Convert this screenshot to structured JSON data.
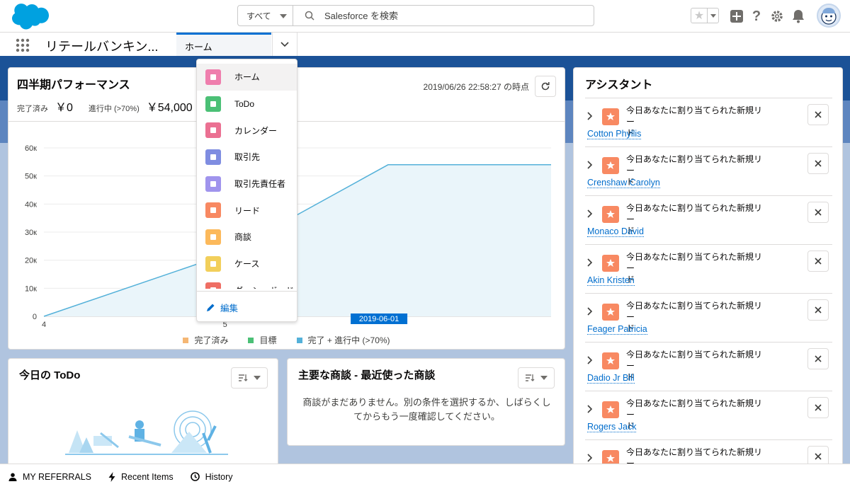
{
  "header": {
    "search_scope": "すべて",
    "search_placeholder": "Salesforce を検索"
  },
  "nav": {
    "app_name": "リテールバンキン...",
    "active_tab": "ホーム"
  },
  "dropdown": {
    "items": [
      {
        "label": "ホーム",
        "icon": "home-icon",
        "color": "#ef7ead"
      },
      {
        "label": "ToDo",
        "icon": "task-icon",
        "color": "#4bc076"
      },
      {
        "label": "カレンダー",
        "icon": "calendar-icon",
        "color": "#eb7092"
      },
      {
        "label": "取引先",
        "icon": "account-icon",
        "color": "#7f8de1"
      },
      {
        "label": "取引先責任者",
        "icon": "contact-icon",
        "color": "#a094ed"
      },
      {
        "label": "リード",
        "icon": "lead-icon",
        "color": "#f88962"
      },
      {
        "label": "商談",
        "icon": "opportunity-icon",
        "color": "#fcb95b"
      },
      {
        "label": "ケース",
        "icon": "case-icon",
        "color": "#f2cf5b"
      },
      {
        "label": "ダッシュボード",
        "icon": "dashboard-icon",
        "color": "#ef6e64"
      }
    ],
    "edit_label": "編集"
  },
  "performance": {
    "title": "四半期パフォーマンス",
    "closed_label": "完了済み",
    "closed_value": "￥0",
    "open_label": "進行中 (>70%)",
    "open_value": "￥54,000",
    "timestamp": "2019/06/26 22:58:27 の時点"
  },
  "chart_data": {
    "type": "area",
    "x": [
      4,
      5,
      5.9,
      6.8
    ],
    "x_ticks": [
      "4",
      "5"
    ],
    "xlim": [
      4,
      6.8
    ],
    "ylim": [
      0,
      60000
    ],
    "y_ticks": [
      "0",
      "10к",
      "20к",
      "30к",
      "40к",
      "50к",
      "60к"
    ],
    "series": [
      {
        "name": "完了 + 進行中 (>70%)",
        "values": [
          0,
          22000,
          54000,
          54000
        ],
        "color": "#54b1d9"
      }
    ],
    "legend": [
      {
        "name": "完了済み",
        "color": "#f5b774"
      },
      {
        "name": "目標",
        "color": "#4bc076"
      },
      {
        "name": "完了 + 進行中 (>70%)",
        "color": "#54b1d9"
      }
    ],
    "marker_label": "2019-06-01",
    "legend_position": "bottom"
  },
  "todo": {
    "title": "今日の ToDo"
  },
  "opportunities": {
    "title": "主要な商談 - 最近使った商談",
    "empty_line1": "商談がまだありません。別の条件を選択するか、しばらくし",
    "empty_line2": "てからもう一度確認してください。"
  },
  "assistant": {
    "title": "アシスタント",
    "items": [
      {
        "line1": "今日あなたに割り当てられた新規リー",
        "line2": "ド",
        "name": "Cotton Phyllis"
      },
      {
        "line1": "今日あなたに割り当てられた新規リー",
        "line2": "ド",
        "name": "Crenshaw Carolyn"
      },
      {
        "line1": "今日あなたに割り当てられた新規リー",
        "line2": "ド",
        "name": "Monaco David"
      },
      {
        "line1": "今日あなたに割り当てられた新規リー",
        "line2": "ド",
        "name": "Akin Kristen"
      },
      {
        "line1": "今日あなたに割り当てられた新規リー",
        "line2": "ド",
        "name": "Feager Patricia"
      },
      {
        "line1": "今日あなたに割り当てられた新規リー",
        "line2": "ド",
        "name": "Dadio Jr Bill"
      },
      {
        "line1": "今日あなたに割り当てられた新規リー",
        "line2": "ド",
        "name": "Rogers Jack"
      },
      {
        "line1": "今日あなたに割り当てられた新規リー",
        "line2": "ド",
        "name": ""
      }
    ]
  },
  "utility": {
    "referrals": "MY REFERRALS",
    "recent": "Recent Items",
    "history": "History"
  }
}
